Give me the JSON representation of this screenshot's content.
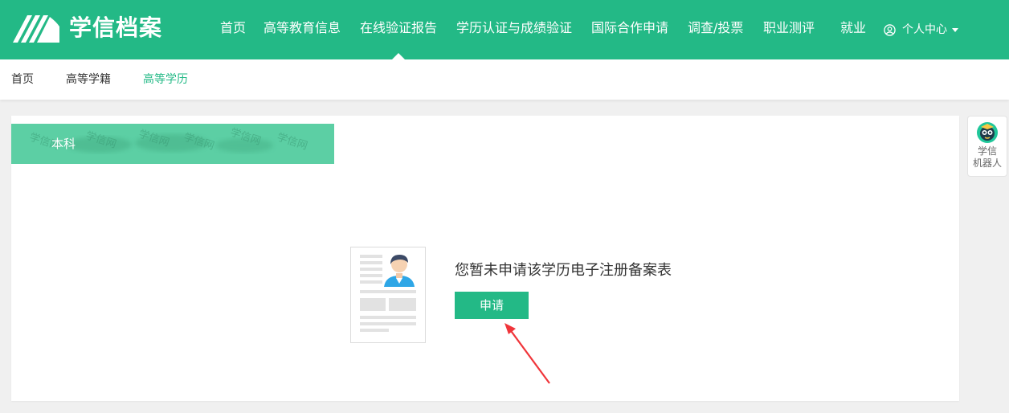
{
  "brand": {
    "name": "学信档案"
  },
  "nav": {
    "items": [
      {
        "label": "首页"
      },
      {
        "label": "高等教育信息"
      },
      {
        "label": "在线验证报告",
        "active": true
      },
      {
        "label": "学历认证与成绩验证"
      },
      {
        "label": "国际合作申请"
      },
      {
        "label": "调查/投票"
      },
      {
        "label": "职业测评"
      },
      {
        "label": "就业"
      }
    ],
    "user_center": "个人中心"
  },
  "subnav": {
    "items": [
      {
        "label": "首页"
      },
      {
        "label": "高等学籍"
      },
      {
        "label": "高等学历",
        "active": true
      }
    ]
  },
  "main": {
    "tab_label": "本科",
    "watermark_text": "学信网",
    "empty_message": "您暂未申请该学历电子注册备案表",
    "apply_label": "申请"
  },
  "robot": {
    "line1": "学信",
    "line2": "机器人"
  },
  "colors": {
    "brand_green": "#23b986",
    "tab_green": "#5ccfa4",
    "arrow_red": "#f0353a"
  }
}
